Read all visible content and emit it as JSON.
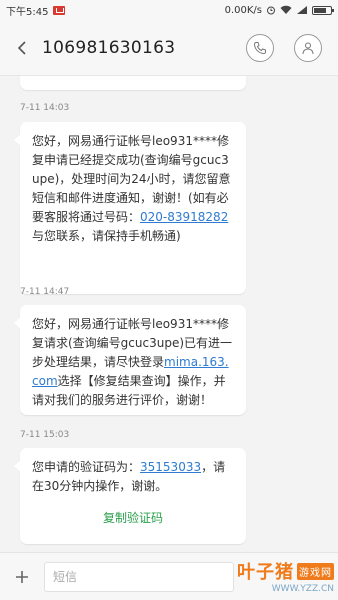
{
  "status_bar": {
    "time": "下午5:45",
    "net_speed": "0.00K/s",
    "notification_icon": "mail-notification-icon"
  },
  "header": {
    "title": "106981630163",
    "back_icon": "back-arrow-icon",
    "call_icon": "phone-icon",
    "contact_icon": "person-icon"
  },
  "messages": [
    {
      "time": "7-11 14:03",
      "parts": [
        {
          "text": "您好，网易通行证帐号leo931****修复申请已经提交成功(查询编号gcuc3upe)，处理时间为24小时，请您留意短信和邮件进度通知，谢谢！(如有必要客服将通过号码："
        },
        {
          "link": "020-83918282"
        },
        {
          "text": "与您联系，请保持手机畅通)"
        }
      ]
    },
    {
      "time": "7-11 14:47",
      "parts": [
        {
          "text": "您好，网易通行证帐号leo931****修复请求(查询编号gcuc3upe)已有进一步处理结果，请尽快登录"
        },
        {
          "link": "mima.163.com"
        },
        {
          "text": "选择【修复结果查询】操作，并请对我们的服务进行评价，谢谢！"
        }
      ]
    },
    {
      "time": "7-11 15:03",
      "parts": [
        {
          "text": "您申请的验证码为："
        },
        {
          "link": "35153033"
        },
        {
          "text": "，请在30分钟内操作，谢谢。"
        }
      ],
      "action": "复制验证码"
    }
  ],
  "input": {
    "placeholder": "短信"
  },
  "watermark": {
    "logo": "叶子猪",
    "badge": "游戏网",
    "url": "WWW.YZZ.CN"
  },
  "colors": {
    "link": "#2e7bd1",
    "action": "#2a9e4a",
    "background": "#f3f3f3"
  }
}
